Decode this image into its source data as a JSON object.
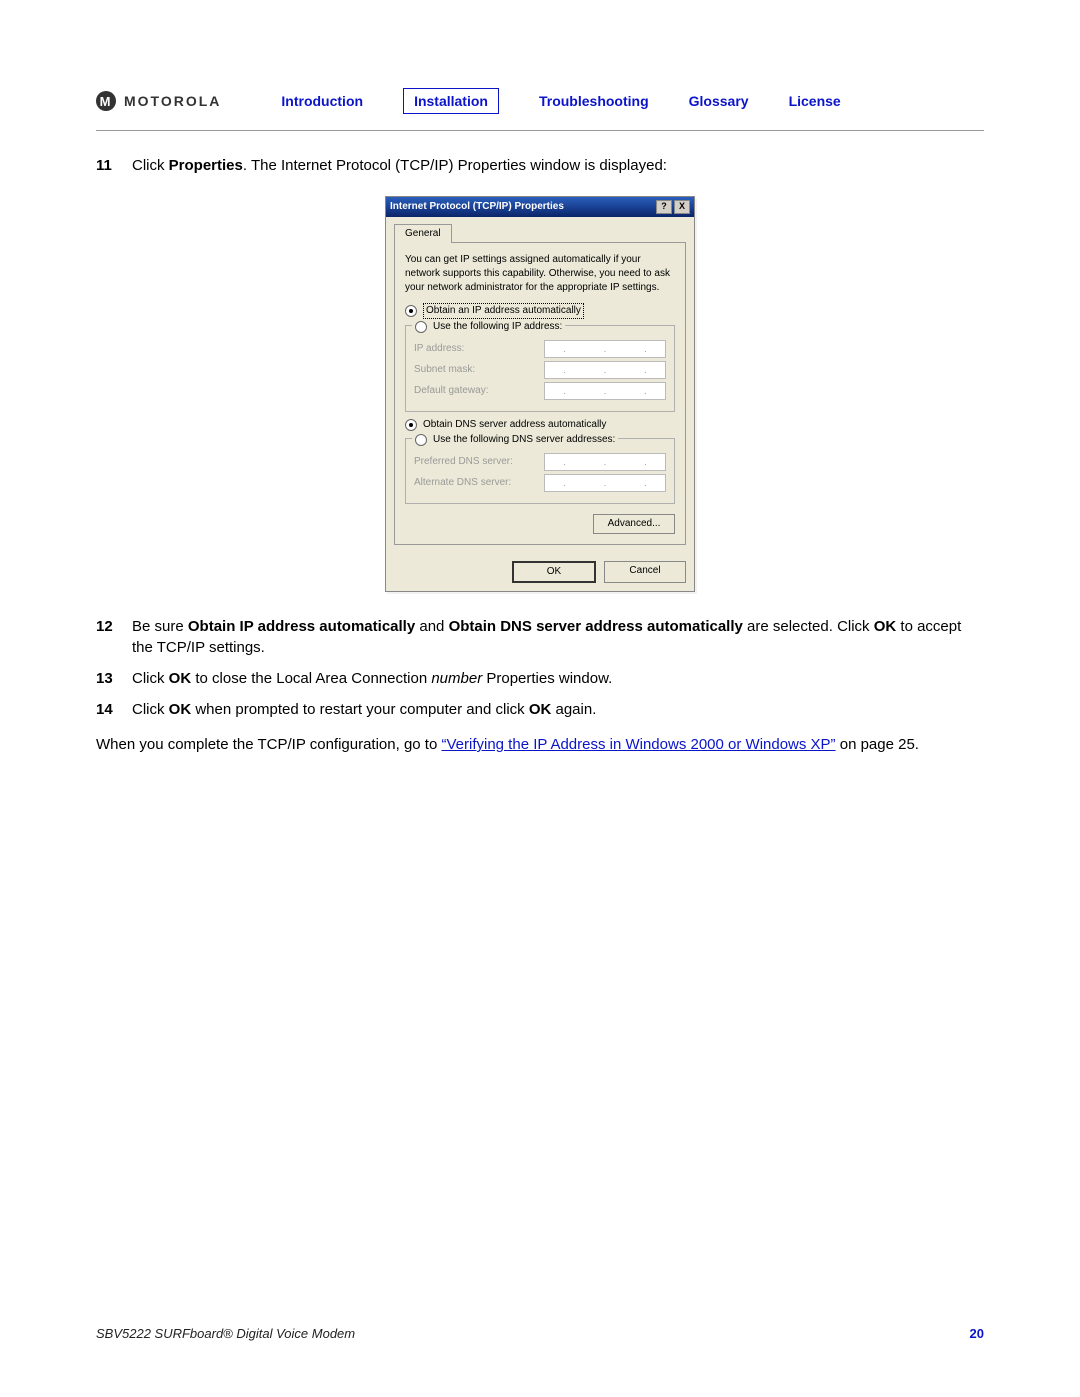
{
  "brand": "MOTOROLA",
  "nav": {
    "intro": "Introduction",
    "install": "Installation",
    "trouble": "Troubleshooting",
    "glossary": "Glossary",
    "license": "License"
  },
  "steps": {
    "s11": {
      "n": "11",
      "pre": "Click ",
      "b": "Properties",
      "post": ". The Internet Protocol (TCP/IP) Properties window is displayed:"
    },
    "s12": {
      "n": "12",
      "t1": "Be sure ",
      "b1": "Obtain IP address automatically",
      "t2": " and ",
      "b2": "Obtain DNS server address automatically",
      "t3": " are selected. Click ",
      "b3": "OK",
      "t4": " to accept the TCP/IP settings."
    },
    "s13": {
      "n": "13",
      "t1": "Click ",
      "b1": "OK",
      "t2": " to close the Local Area Connection ",
      "i": "number",
      "t3": " Properties window."
    },
    "s14": {
      "n": "14",
      "t1": "Click ",
      "b1": "OK",
      "t2": " when prompted to restart your computer and click ",
      "b2": "OK",
      "t3": " again."
    }
  },
  "closing": {
    "t1": "When you complete the TCP/IP configuration, go to ",
    "link": "“Verifying the IP Address in Windows 2000 or Windows XP”",
    "t2": " on page 25."
  },
  "dialog": {
    "title": "Internet Protocol (TCP/IP) Properties",
    "help": "?",
    "close": "X",
    "tab": "General",
    "desc": "You can get IP settings assigned automatically if your network supports this capability. Otherwise, you need to ask your network administrator for the appropriate IP settings.",
    "r1": "Obtain an IP address automatically",
    "r2": "Use the following IP address:",
    "ip": "IP address:",
    "mask": "Subnet mask:",
    "gw": "Default gateway:",
    "r3": "Obtain DNS server address automatically",
    "r4": "Use the following DNS server addresses:",
    "pdns": "Preferred DNS server:",
    "adns": "Alternate DNS server:",
    "adv": "Advanced...",
    "ok": "OK",
    "cancel": "Cancel"
  },
  "footer": {
    "product": "SBV5222 SURFboard® Digital Voice Modem",
    "page": "20"
  }
}
